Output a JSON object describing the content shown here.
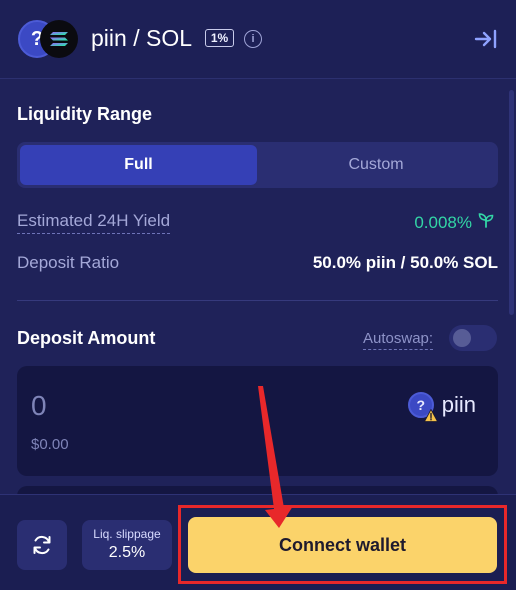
{
  "header": {
    "token_a_symbol": "?",
    "pair_title": "piin / SOL",
    "fee_tier": "1%",
    "info_icon": "info-icon",
    "collapse_icon": "collapse-right-icon"
  },
  "liquidity_range": {
    "title": "Liquidity Range",
    "options": [
      "Full",
      "Custom"
    ],
    "selected": "Full"
  },
  "stats": {
    "yield_label": "Estimated 24H Yield",
    "yield_value": "0.008%",
    "ratio_label": "Deposit Ratio",
    "ratio_value": "50.0% piin / 50.0% SOL"
  },
  "deposit": {
    "title": "Deposit Amount",
    "autoswap_label": "Autoswap:",
    "autoswap_on": false,
    "amount": "0",
    "usd": "$0.00",
    "token_icon_text": "?",
    "token": "piin"
  },
  "footer": {
    "slippage_label": "Liq. slippage",
    "slippage_value": "2.5%",
    "connect_label": "Connect wallet"
  },
  "colors": {
    "background": "#1f2259",
    "accent": "#3540b6",
    "yield_green": "#33d6a6",
    "connect_yellow": "#fbd36a",
    "annotation_red": "#e8282a"
  }
}
